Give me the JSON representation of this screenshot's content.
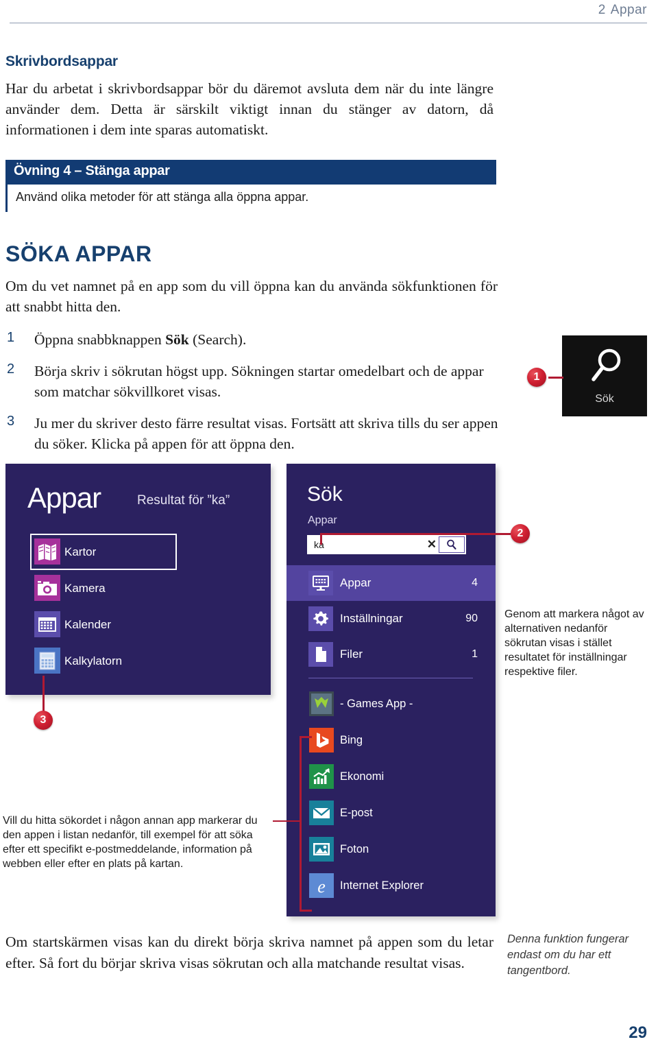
{
  "running_head": {
    "chapter_number": "2",
    "chapter_title": "Appar"
  },
  "section": {
    "subheading": "Skrivbordsappar",
    "intro_paragraph": "Har du arbetat i skrivbordsappar bör du däremot avsluta dem när du inte längre använder dem. Detta är särskilt viktigt innan du stänger av datorn, då informationen i dem inte sparas automatiskt."
  },
  "exercise": {
    "title": "Övning 4 – Stänga appar",
    "description": "Använd olika metoder för att stänga alla öppna appar."
  },
  "search_section": {
    "heading": "SÖKA APPAR",
    "intro": "Om du vet namnet på en app som du vill öppna kan du använda sökfunktionen för att snabbt hitta den.",
    "steps": [
      {
        "number": "1",
        "text_before": "Öppna snabbknappen ",
        "bold": "Sök",
        "text_after": " (Search)."
      },
      {
        "number": "2",
        "text_before": "Börja skriv i sökrutan högst upp. Sökningen startar omedelbart och de appar som matchar sökvillkoret visas.",
        "bold": "",
        "text_after": ""
      },
      {
        "number": "3",
        "text_before": "Ju mer du skriver desto färre resultat visas. Fortsätt att skriva tills du ser appen du söker. Klicka på appen för att öppna den.",
        "bold": "",
        "text_after": ""
      }
    ]
  },
  "search_tile": {
    "label": "Sök",
    "icon": "search-icon",
    "background": "#111111"
  },
  "callout_badges": [
    {
      "number": "1"
    },
    {
      "number": "2"
    },
    {
      "number": "3"
    }
  ],
  "apps_panel": {
    "title": "Appar",
    "result_label": "Resultat för ”ka”",
    "items": [
      {
        "name": "Kartor",
        "icon": "maps-icon",
        "color": "#a6319b",
        "selected": true
      },
      {
        "name": "Kamera",
        "icon": "camera-icon",
        "color": "#a6319b",
        "selected": false
      },
      {
        "name": "Kalender",
        "icon": "calendar-icon",
        "color": "#5b4dab",
        "selected": false
      },
      {
        "name": "Kalkylatorn",
        "icon": "calculator-icon",
        "color": "#4a74c4",
        "selected": false
      }
    ]
  },
  "search_panel": {
    "title": "Sök",
    "scope_label": "Appar",
    "search_input": {
      "value": "ka",
      "placeholder": "Sök",
      "clear_icon": "close-icon",
      "submit_icon": "search-icon"
    },
    "scopes": [
      {
        "name": "Appar",
        "count": "4",
        "icon": "monitor-icon",
        "active": true
      },
      {
        "name": "Inställningar",
        "count": "90",
        "icon": "gear-icon",
        "active": false
      },
      {
        "name": "Filer",
        "count": "1",
        "icon": "file-icon",
        "active": false
      }
    ],
    "results": [
      {
        "name": "- Games App -",
        "icon": "games-app-icon",
        "color": "#3c4a52"
      },
      {
        "name": "Bing",
        "icon": "bing-icon",
        "color": "#e8491f"
      },
      {
        "name": "Ekonomi",
        "icon": "finance-icon",
        "color": "#1f9249"
      },
      {
        "name": "E-post",
        "icon": "mail-icon",
        "color": "#18809a"
      },
      {
        "name": "Foton",
        "icon": "photos-icon",
        "color": "#18809a"
      },
      {
        "name": "Internet Explorer",
        "icon": "internet-explorer-icon",
        "color": "#5d8ad4"
      }
    ]
  },
  "notes": {
    "right": "Genom att markera något av alternativen nedanför sökrutan visas i stället resultatet för inställningar respektive filer.",
    "left": "Vill du hitta sökordet i någon annan app markerar du den appen i listan nedanför, till exempel för att söka efter ett specifikt e-postmeddelande, information på webben eller efter en plats på kartan."
  },
  "closing": {
    "paragraph": "Om startskärmen visas kan du direkt börja skriva namnet på appen som du letar efter. Så fort du börjar skriva visas sökrutan och alla matchande resultat visas.",
    "margin_note": "Denna funktion fungerar endast om du har ett tangentbord."
  },
  "page_number": "29",
  "colors": {
    "heading_blue": "#17406e",
    "exercise_navy": "#123b73",
    "badge_red": "#cf1f31",
    "panel_purple": "#2b2160"
  }
}
